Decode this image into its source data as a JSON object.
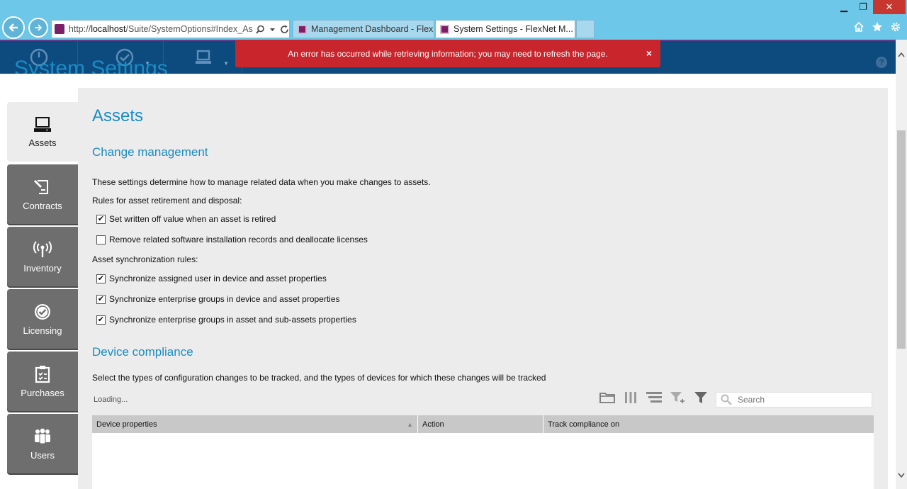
{
  "browser": {
    "url_prefix": "http://",
    "url_host": "localhost",
    "url_path": "/Suite/SystemOptions#Index_Ass",
    "tabs": [
      {
        "label": "Management Dashboard - Flex..."
      },
      {
        "label": "System Settings - FlexNet M..."
      }
    ],
    "window_controls": {
      "minimize": "▁",
      "maximize": "❐",
      "close": "✕"
    },
    "close_tab_glyph": "✕"
  },
  "app": {
    "error_message": "An error has occurred while retrieving information; you may need to refresh the page.",
    "error_close": "×",
    "help": "?",
    "page_title_peek": "System Settings"
  },
  "sidebar": {
    "items": [
      {
        "label": "Assets",
        "icon": "laptop-icon"
      },
      {
        "label": "Contracts",
        "icon": "contract-signing-icon"
      },
      {
        "label": "Inventory",
        "icon": "antenna-icon"
      },
      {
        "label": "Licensing",
        "icon": "check-badge-icon"
      },
      {
        "label": "Purchases",
        "icon": "clipboard-check-icon"
      },
      {
        "label": "Users",
        "icon": "users-group-icon"
      }
    ]
  },
  "main": {
    "title": "Assets",
    "change_management": {
      "heading": "Change management",
      "description": "These settings determine how to manage related data when you make changes to assets.",
      "retirement_label": "Rules for asset retirement and disposal:",
      "retirement_rules": [
        {
          "label": "Set written off value when an asset is retired",
          "checked": true
        },
        {
          "label": "Remove related software installation records and deallocate licenses",
          "checked": false
        }
      ],
      "sync_label": "Asset synchronization rules:",
      "sync_rules": [
        {
          "label": "Synchronize assigned user in device and asset properties",
          "checked": true
        },
        {
          "label": "Synchronize enterprise groups in device and asset properties",
          "checked": true
        },
        {
          "label": "Synchronize enterprise groups in asset and sub-assets properties",
          "checked": true
        }
      ]
    },
    "device_compliance": {
      "heading": "Device compliance",
      "description": "Select the types of configuration changes to be tracked, and the types of devices for which these changes will be tracked",
      "loading": "Loading...",
      "search_placeholder": "Search",
      "columns": [
        "Device properties",
        "Action",
        "Track compliance on"
      ]
    }
  },
  "colors": {
    "chrome": "#6cc7e9",
    "header": "#0d4b7e",
    "error": "#c9252c",
    "heading_blue": "#1a8bc5",
    "sidebar_tab": "#6e6e6e"
  }
}
